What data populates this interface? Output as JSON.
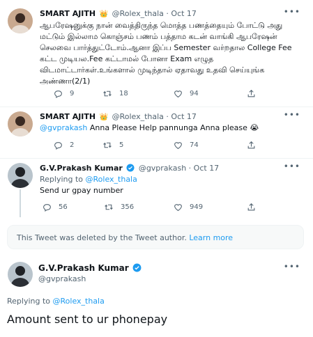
{
  "tweets": [
    {
      "name": "SMART AJITH",
      "handle": "@Rolex_thala",
      "time": "Oct 17",
      "text": "ஆபரேஷனுக்கு நான் வைத்திருந்த மொத்த பணத்தையும் போட்டு அது மட்டும் இல்லாம கொஞ்சம் பணம் பத்தாம கடன் வாங்கி ஆபரேஷன் செலவை பார்த்துட்டோம்.ஆனா இப்ப Semester வர்றதால College Fee கட்ட முடியல.Fee கட்டாமல் போனா Exam எழுத விடமாட்டார்கள்.உங்களால் முடிந்தால் ஏதாவது உதவி செய்யுங்க அண்ணா(2/1)",
      "replies": "9",
      "retweets": "18",
      "likes": "94"
    },
    {
      "name": "SMART AJITH",
      "handle": "@Rolex_thala",
      "time": "Oct 17",
      "mention": "@gvprakash",
      "text": " Anna Please Help pannunga Anna please ",
      "emoji": "😭",
      "replies": "2",
      "retweets": "5",
      "likes": "74"
    },
    {
      "name": "G.V.Prakash Kumar",
      "handle": "@gvprakash",
      "time": "Oct 17",
      "replying_label": "Replying to ",
      "replying_to": "@Rolex_thala",
      "text": "Send ur gpay number",
      "replies": "56",
      "retweets": "356",
      "likes": "949"
    }
  ],
  "deleted_notice": {
    "text": "This Tweet was deleted by the Tweet author. ",
    "link": "Learn more"
  },
  "main_tweet": {
    "name": "G.V.Prakash Kumar",
    "handle": "@gvprakash",
    "replying_label": "Replying to ",
    "replying_to": "@Rolex_thala",
    "text": "Amount sent to ur phonepay"
  },
  "icons": {
    "reply": "reply-icon",
    "retweet": "retweet-icon",
    "like": "heart-icon",
    "share": "share-icon",
    "more": "more-icon",
    "verified": "verified-badge-icon",
    "crown": "crown-icon"
  },
  "colors": {
    "accent": "#1d9bf0",
    "text": "#0f1419",
    "muted": "#536471",
    "divider": "#eff3f4",
    "crown": "#f5b700"
  }
}
